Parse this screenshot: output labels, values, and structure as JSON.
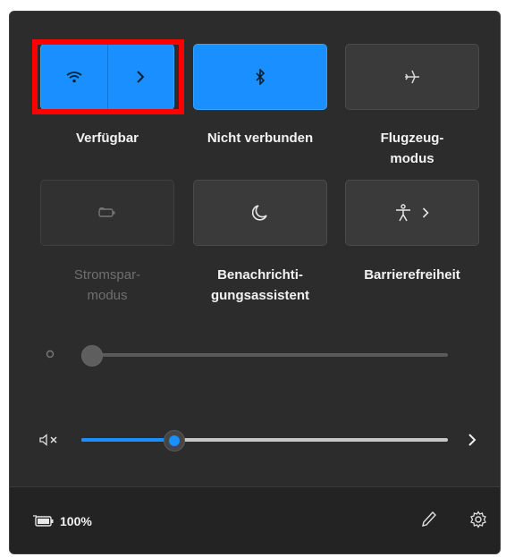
{
  "quick_settings": {
    "wifi": {
      "label": "Verfügbar",
      "state": "on"
    },
    "bluetooth": {
      "label": "Nicht verbunden",
      "state": "on"
    },
    "airplane": {
      "label_line1": "Flugzeug-",
      "label_line2": "modus",
      "state": "off"
    },
    "battery_saver": {
      "label_line1": "Stromspar-",
      "label_line2": "modus",
      "state": "disabled"
    },
    "focus_assist": {
      "label_line1": "Benachrichti-",
      "label_line2": "gungsassistent",
      "state": "off"
    },
    "accessibility": {
      "label": "Barrierefreiheit",
      "state": "off"
    }
  },
  "sliders": {
    "brightness": {
      "level": 0.0,
      "enabled": false
    },
    "volume": {
      "level": 0.25,
      "muted": true
    }
  },
  "footer": {
    "battery_percent": "100%"
  },
  "icons": {
    "wifi": "wifi-icon",
    "wifi_expand": "chevron-right-icon",
    "bluetooth": "bluetooth-icon",
    "airplane": "airplane-icon",
    "battery_saver": "battery-saver-icon",
    "focus_assist": "moon-icon",
    "accessibility": "accessibility-icon",
    "brightness": "sun-icon",
    "volume": "speaker-muted-icon",
    "audio_output": "chevron-right-icon",
    "battery": "battery-icon",
    "edit": "pencil-icon",
    "settings": "gear-icon"
  },
  "colors": {
    "accent": "#1a8fff",
    "panel_bg": "#2c2c2c",
    "tile_off": "#3a3a3a",
    "highlight": "#ff0000"
  }
}
